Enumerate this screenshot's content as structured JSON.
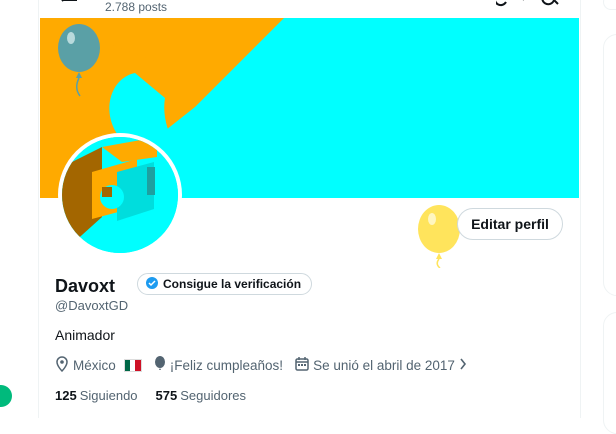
{
  "header": {
    "posts_count": "2.788 posts"
  },
  "profile": {
    "name": "Davoxt",
    "verification_label": "Consigue la verificación",
    "handle": "@DavoxtGD",
    "bio": "Animador",
    "edit_label": "Editar perfil"
  },
  "meta": {
    "location": "México",
    "birthday": "¡Feliz cumpleaños!",
    "joined": "Se unió el abril de 2017"
  },
  "stats": {
    "following_count": "125",
    "following_label": "Siguiendo",
    "followers_count": "575",
    "followers_label": "Seguidores"
  },
  "colors": {
    "banner_orange": "#ffaa00",
    "banner_cyan": "#00ffff",
    "balloon_yellow": "#ffe45c",
    "verify_blue": "#1d9bf0"
  },
  "icons": [
    "back-arrow-icon",
    "search-icon",
    "location-pin-icon",
    "balloon-icon",
    "calendar-icon",
    "chevron-right-icon",
    "verified-badge-icon"
  ]
}
